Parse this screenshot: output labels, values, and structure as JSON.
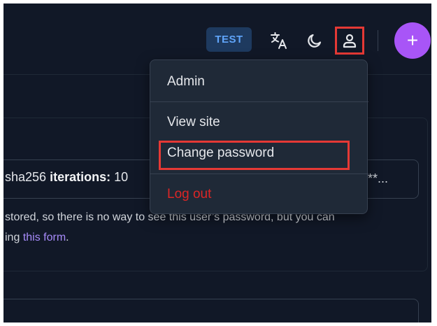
{
  "header": {
    "env_badge": "TEST",
    "icons": {
      "translate": "translate-icon",
      "theme": "moon-icon",
      "user": "user-icon",
      "add": "plus-icon"
    },
    "add_label": "+"
  },
  "background": {
    "hash_prefix": "sha256",
    "hash_iterations_label": "iterations:",
    "hash_iterations_value": "10",
    "hash_mask": "**...",
    "help_line1": "stored, so there is no way to see this user’s password, but you can",
    "help_line2_prefix": "ing",
    "help_link": "this form",
    "help_line2_suffix": "."
  },
  "user_menu": {
    "items": [
      {
        "label": "Admin"
      },
      {
        "label": "View site"
      },
      {
        "label": "Change password"
      },
      {
        "label": "Log out"
      }
    ]
  },
  "colors": {
    "background": "#111827",
    "menu_bg": "#1f2937",
    "accent": "#a855f7",
    "badge_bg": "#1e3a5f",
    "badge_text": "#60a5fa",
    "danger": "#dc2626",
    "link": "#a78bfa",
    "annotation": "#e53935"
  }
}
